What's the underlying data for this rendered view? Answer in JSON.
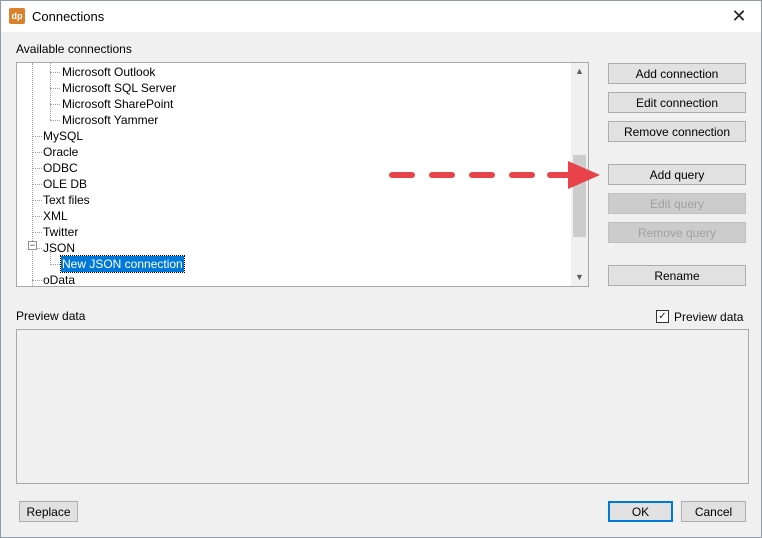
{
  "window": {
    "title": "Connections",
    "app_icon": "dp"
  },
  "connections": {
    "label": "Available connections",
    "tree_items": [
      {
        "label": "Microsoft Outlook"
      },
      {
        "label": "Microsoft SQL Server"
      },
      {
        "label": "Microsoft SharePoint"
      },
      {
        "label": "Microsoft Yammer"
      },
      {
        "label": "MySQL"
      },
      {
        "label": "Oracle"
      },
      {
        "label": "ODBC"
      },
      {
        "label": "OLE DB"
      },
      {
        "label": "Text files"
      },
      {
        "label": "XML"
      },
      {
        "label": "Twitter"
      },
      {
        "label": "JSON",
        "expanded": true
      },
      {
        "label": "New JSON connection",
        "selected": true
      },
      {
        "label": "oData"
      }
    ]
  },
  "buttons": {
    "add_connection": "Add connection",
    "edit_connection": "Edit connection",
    "remove_connection": "Remove connection",
    "add_query": "Add query",
    "edit_query": "Edit query",
    "remove_query": "Remove query",
    "rename": "Rename",
    "replace": "Replace",
    "ok": "OK",
    "cancel": "Cancel"
  },
  "preview": {
    "label": "Preview data",
    "checkbox_label": "Preview data",
    "checked": true
  },
  "colors": {
    "selection": "#0078d7",
    "arrow": "#e8424a"
  }
}
